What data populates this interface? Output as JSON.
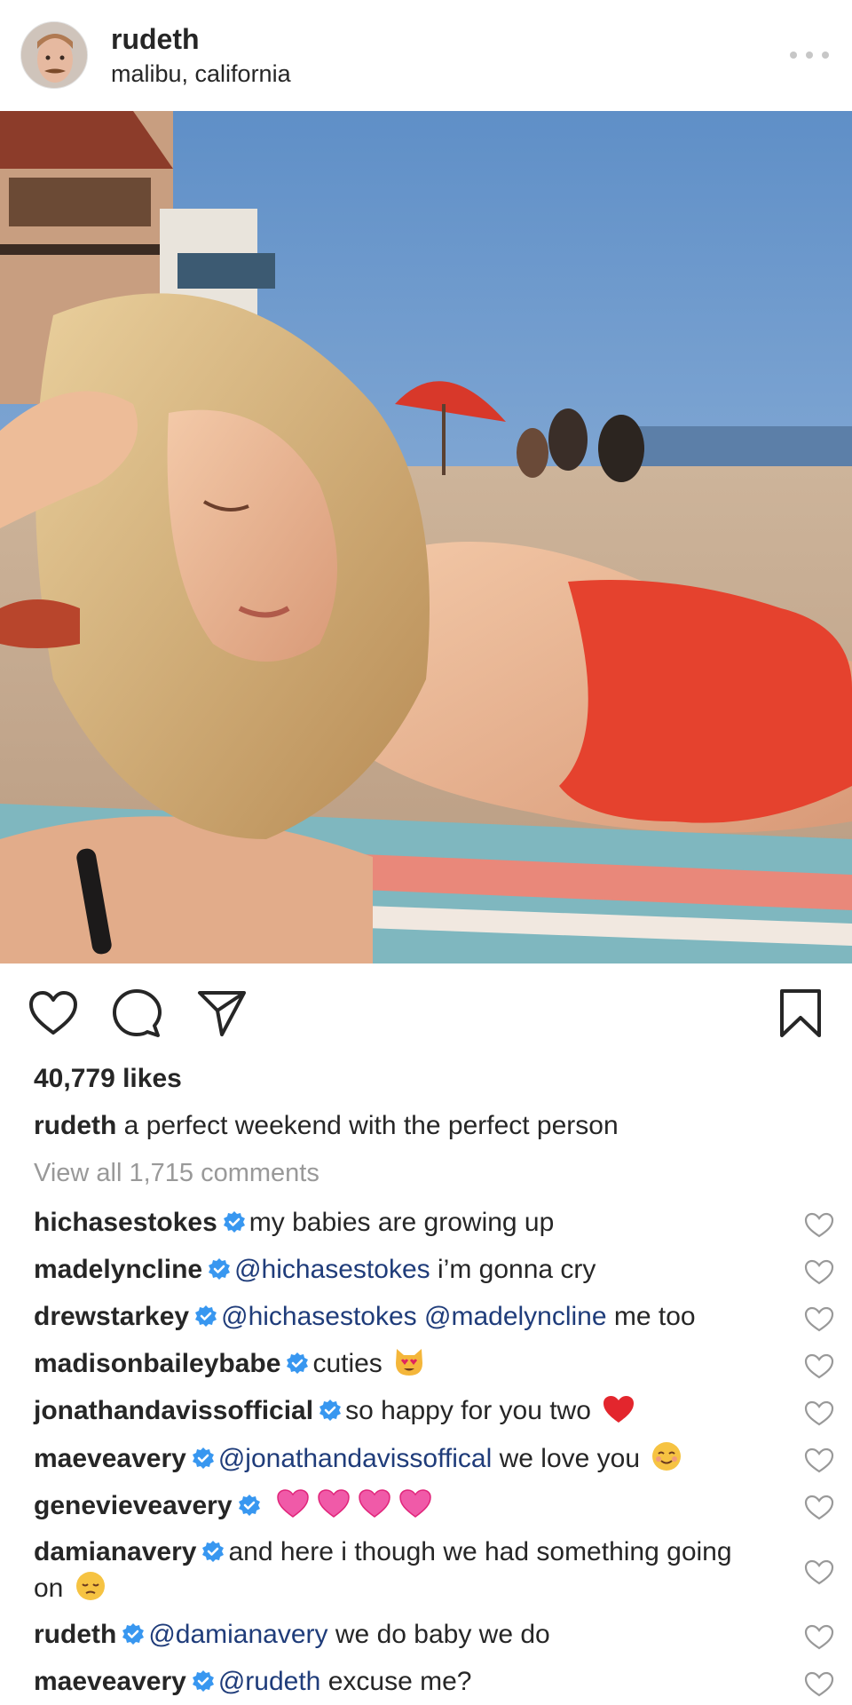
{
  "post": {
    "username": "rudeth",
    "location": "malibu, california",
    "likes": "40,779 likes",
    "caption_user": "rudeth",
    "caption_text": "a perfect weekend with the perfect person",
    "view_all": "View all 1,715 comments"
  },
  "comments": [
    {
      "user": "hichasestokes",
      "text": "my babies are growing up"
    },
    {
      "user": "madelyncline",
      "mention": "@hichasestokes",
      "text": "i’m gonna cry"
    },
    {
      "user": "drewstarkey",
      "mention": "@hichasestokes @madelyncline",
      "text": "me too"
    },
    {
      "user": "madisonbaileybabe",
      "text": "cuties",
      "emoji": "heart-eyes-cat"
    },
    {
      "user": "jonathandavissofficial",
      "text": "so happy for you two",
      "emoji": "red-heart"
    },
    {
      "user": "maeveavery",
      "mention": "@jonathandavissoffical",
      "text": "we love you",
      "emoji": "smiling-blush"
    },
    {
      "user": "genevieveavery",
      "emoji": "pink-hearts"
    },
    {
      "user": "damianavery",
      "text": "and here i though we had something going on",
      "emoji": "pensive-face"
    },
    {
      "user": "rudeth",
      "mention": "@damianavery",
      "text": "we do baby we do"
    },
    {
      "user": "maeveavery",
      "mention": "@rudeth",
      "text": "excuse me?"
    }
  ],
  "icons": {
    "like": "heart-outline-icon",
    "comment": "comment-bubble-icon",
    "share": "paper-plane-icon",
    "save": "bookmark-icon",
    "verified": "verified-badge-icon"
  },
  "colors": {
    "verified": "#3897f0",
    "mention": "#1f3c7a",
    "muted": "#999999",
    "text": "#262626"
  }
}
